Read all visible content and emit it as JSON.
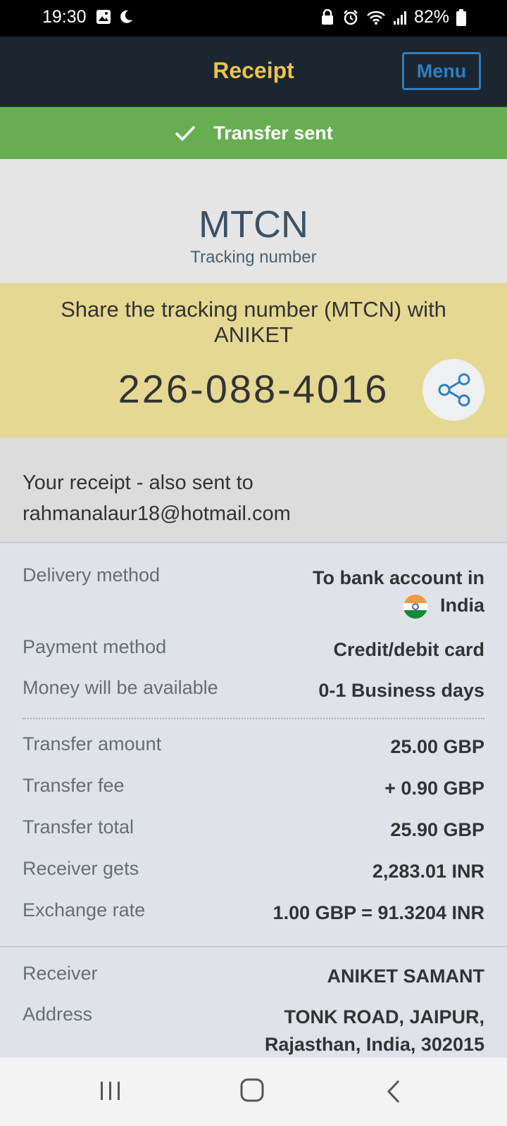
{
  "status_bar": {
    "time": "19:30",
    "battery": "82%",
    "icons": [
      "image-icon",
      "moon-icon",
      "lock-icon",
      "alarm-icon",
      "wifi-icon",
      "signal-icon",
      "battery-icon"
    ]
  },
  "header": {
    "title": "Receipt",
    "menu_label": "Menu",
    "title_color": "#ecc34d",
    "accent_color": "#2f7fc1"
  },
  "banner": {
    "text": "Transfer sent",
    "color": "#67ae53"
  },
  "mtcn": {
    "title": "MTCN",
    "subtitle": "Tracking number"
  },
  "share": {
    "text": "Share the tracking number (MTCN) with ANIKET",
    "number": "226-088-4016",
    "background": "#e5d893"
  },
  "receipt": {
    "text": "Your receipt - also sent to rahmanalaur18@hotmail.com"
  },
  "details": {
    "delivery_method": {
      "label": "Delivery method",
      "value_line1": "To bank account in",
      "value_country": "India"
    },
    "payment_method": {
      "label": "Payment method",
      "value": "Credit/debit card"
    },
    "availability": {
      "label": "Money will be available",
      "value": "0-1 Business days"
    },
    "transfer_amount": {
      "label": "Transfer amount",
      "value": "25.00 GBP"
    },
    "transfer_fee": {
      "label": "Transfer fee",
      "value": "+ 0.90 GBP"
    },
    "transfer_total": {
      "label": "Transfer total",
      "value": "25.90 GBP"
    },
    "receiver_gets": {
      "label": "Receiver gets",
      "value": "2,283.01 INR"
    },
    "exchange_rate": {
      "label": "Exchange rate",
      "value": "1.00 GBP = 91.3204 INR"
    },
    "receiver": {
      "label": "Receiver",
      "value": "ANIKET SAMANT"
    },
    "address": {
      "label": "Address",
      "value_line1": "TONK ROAD, JAIPUR,",
      "value_line2": "Rajasthan, India, 302015"
    }
  },
  "nav": {
    "icons": [
      "recent-apps-icon",
      "home-icon",
      "back-icon"
    ]
  }
}
